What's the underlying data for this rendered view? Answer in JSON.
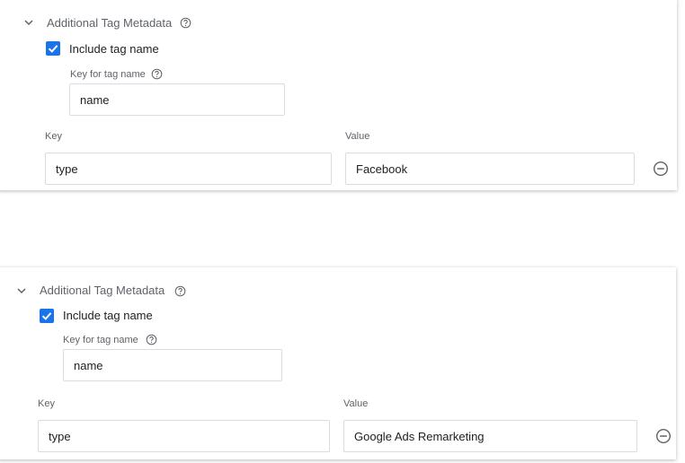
{
  "colors": {
    "accent": "#1a73e8",
    "text": "#202124",
    "secondary_text": "#5f6368",
    "border": "#dadce0"
  },
  "icons": {
    "collapse": "chevron-down-icon",
    "help": "help-circle-icon",
    "check": "check-icon",
    "remove_row": "remove-circle-icon"
  },
  "panels": [
    {
      "section_title": "Additional Tag Metadata",
      "include_tag_name": {
        "label": "Include tag name",
        "checked": true
      },
      "tag_name_key": {
        "label": "Key for tag name",
        "value": "name"
      },
      "key_label": "Key",
      "value_label": "Value",
      "rows": [
        {
          "key": "type",
          "value": "Facebook"
        }
      ]
    },
    {
      "section_title": "Additional Tag Metadata",
      "include_tag_name": {
        "label": "Include tag name",
        "checked": true
      },
      "tag_name_key": {
        "label": "Key for tag name",
        "value": "name"
      },
      "key_label": "Key",
      "value_label": "Value",
      "rows": [
        {
          "key": "type",
          "value": "Google Ads Remarketing"
        }
      ]
    }
  ]
}
